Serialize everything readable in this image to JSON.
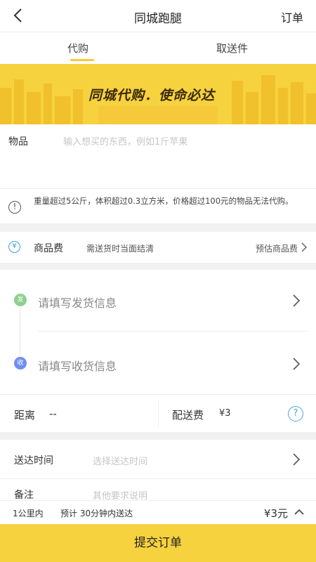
{
  "header": {
    "title": "同城跑腿",
    "orders_label": "订单"
  },
  "tabs": [
    {
      "label": "代购",
      "active": true
    },
    {
      "label": "取送件",
      "active": false
    }
  ],
  "banner": {
    "slogan": "同城代购．使命必达"
  },
  "goods": {
    "label": "物品",
    "placeholder": "输入想买的东西，例如1斤苹果"
  },
  "notice": {
    "icon": "info-icon",
    "text": "重量超过5公斤，体积超过0.3立方米，价格超过100元的物品无法代购。"
  },
  "goods_fee": {
    "icon": "yen-icon",
    "icon_char": "¥",
    "label": "商品费",
    "desc": "需送货时当面结清",
    "estimate_label": "预估商品费"
  },
  "address": {
    "sender": {
      "badge": "发",
      "placeholder": "请填写发货信息"
    },
    "receiver": {
      "badge": "收",
      "placeholder": "请填写收货信息"
    }
  },
  "distance": {
    "label": "距离",
    "value": "--",
    "fee_label": "配送费",
    "fee_value": "¥3",
    "help_icon": "question-icon",
    "help_char": "?"
  },
  "delivery_time": {
    "label": "送达时间",
    "placeholder": "选择送达时间"
  },
  "note": {
    "label": "备注",
    "placeholder": "其他要求说明"
  },
  "summary": {
    "distance": "1公里内",
    "eta": "预计 30分钟内送达",
    "price": "¥3元"
  },
  "submit": {
    "label": "提交订单"
  },
  "colors": {
    "accent": "#f7d23f",
    "sender_badge": "#8ed08f",
    "receiver_badge": "#6f8ef0",
    "link_blue": "#4aa5e8"
  }
}
